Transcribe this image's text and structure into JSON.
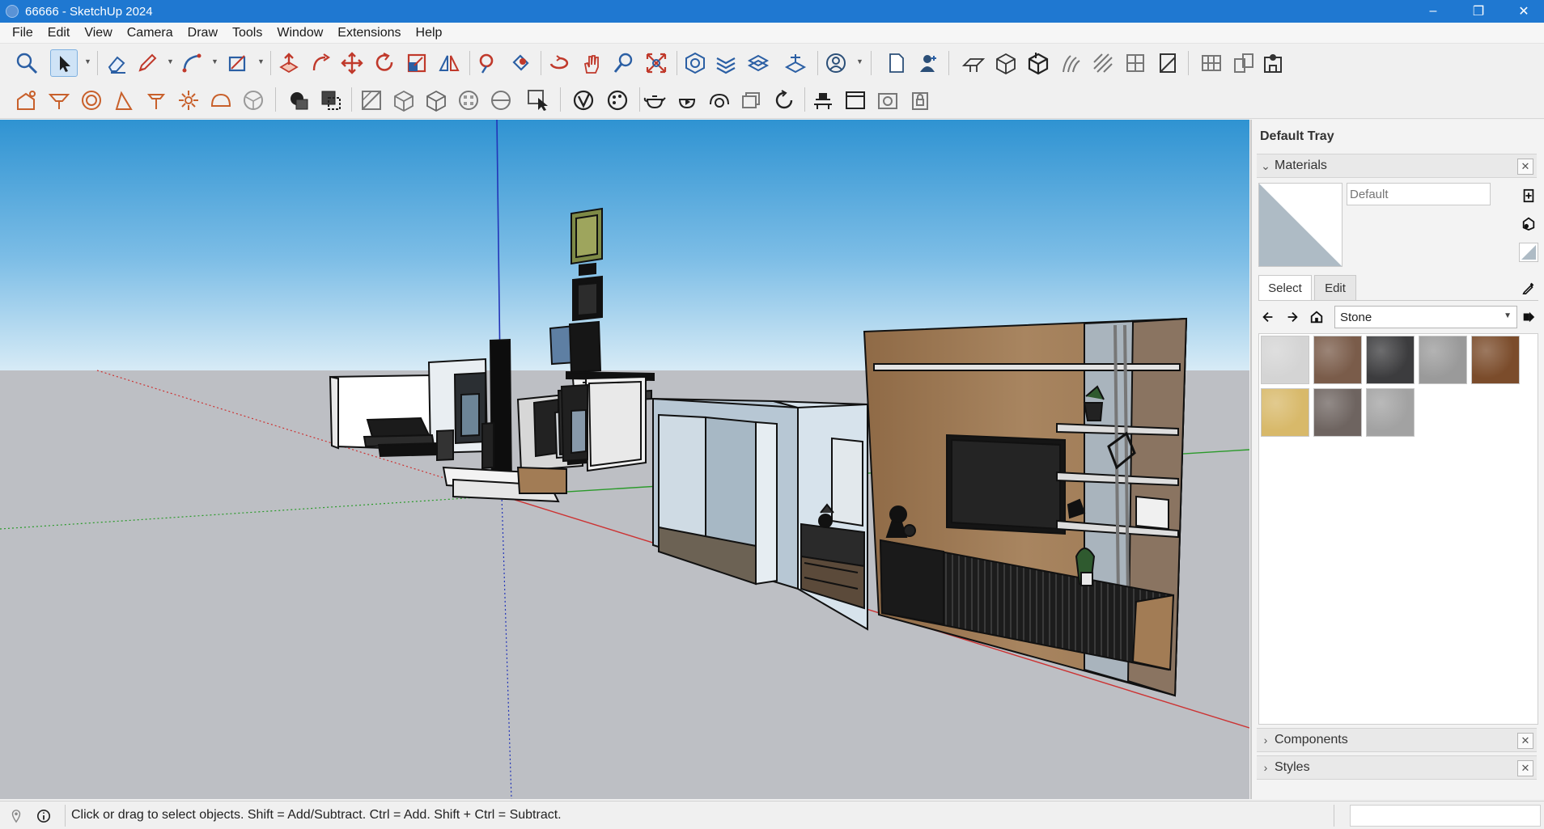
{
  "app": {
    "window_title": "66666 - SketchUp 2024",
    "window_controls": {
      "minimize": "–",
      "restore": "❐",
      "close": "✕"
    }
  },
  "menu": [
    "File",
    "Edit",
    "View",
    "Camera",
    "Draw",
    "Tools",
    "Window",
    "Extensions",
    "Help"
  ],
  "toolbar_large": [
    {
      "name": "zoom-tool",
      "icon": "magnifier"
    },
    {
      "name": "select-tool",
      "icon": "arrow-cursor",
      "active": true
    },
    {
      "name": "eraser-tool",
      "icon": "eraser"
    },
    {
      "name": "line-tool",
      "icon": "pencil"
    },
    {
      "name": "arc-tool",
      "icon": "arc"
    },
    {
      "name": "rectangle-tool",
      "icon": "rectangle"
    },
    {
      "name": "push-pull-tool",
      "icon": "push-pull"
    },
    {
      "name": "follow-me-tool",
      "icon": "follow-me"
    },
    {
      "name": "move-tool",
      "icon": "move"
    },
    {
      "name": "rotate-tool",
      "icon": "rotate"
    },
    {
      "name": "scale-tool",
      "icon": "scale"
    },
    {
      "name": "flip-tool",
      "icon": "flip"
    },
    {
      "name": "tape-measure-tool",
      "icon": "tape"
    },
    {
      "name": "paint-bucket-tool",
      "icon": "paint-bucket"
    },
    {
      "name": "orbit-tool",
      "icon": "orbit"
    },
    {
      "name": "pan-tool",
      "icon": "hand"
    },
    {
      "name": "zoom-window-tool",
      "icon": "zoom"
    },
    {
      "name": "zoom-extents-tool",
      "icon": "zoom-extents"
    },
    {
      "name": "sandbox-smoove-tool",
      "icon": "smoove"
    },
    {
      "name": "sandbox-stamp-tool",
      "icon": "stamp"
    },
    {
      "name": "sandbox-drape-tool",
      "icon": "drape"
    },
    {
      "name": "sandbox-flip-edge-tool",
      "icon": "flip-edge"
    },
    {
      "name": "account-button",
      "icon": "user-circle"
    },
    {
      "name": "new-file-button",
      "icon": "page"
    },
    {
      "name": "add-user-button",
      "icon": "person"
    },
    {
      "name": "section-plane-tool",
      "icon": "section"
    },
    {
      "name": "solid-outer-shell-tool",
      "icon": "box"
    },
    {
      "name": "solid-intersect-tool",
      "icon": "box-cut"
    },
    {
      "name": "solid-union-tool",
      "icon": "solid"
    },
    {
      "name": "solid-subtract-tool",
      "icon": "solid"
    },
    {
      "name": "solid-trim-tool",
      "icon": "solid"
    },
    {
      "name": "solid-split-tool",
      "icon": "solid"
    },
    {
      "name": "solid-inspector-tool",
      "icon": "solid"
    },
    {
      "name": "grid-tool",
      "icon": "grid"
    },
    {
      "name": "layout-tool",
      "icon": "layout"
    },
    {
      "name": "warehouse-tool",
      "icon": "warehouse"
    }
  ],
  "toolbar_small": [
    {
      "name": "photo-texture-tool",
      "icon": "photo"
    },
    {
      "name": "position-camera-tool",
      "icon": "camera"
    },
    {
      "name": "walk-tool",
      "icon": "walk"
    },
    {
      "name": "look-around-tool",
      "icon": "look"
    },
    {
      "name": "section-fill-tool",
      "icon": "section"
    },
    {
      "name": "shadows-tool",
      "icon": "sun"
    },
    {
      "name": "fog-tool",
      "icon": "fog"
    },
    {
      "name": "x-ray-tool",
      "icon": "sphere"
    },
    {
      "name": "back-edges-tool",
      "icon": "edges"
    },
    {
      "name": "wireframe-tool",
      "icon": "wire"
    },
    {
      "name": "hidden-line-tool",
      "icon": "hidden"
    },
    {
      "name": "shaded-tool",
      "icon": "shaded"
    },
    {
      "name": "textured-tool",
      "icon": "textured"
    },
    {
      "name": "monochrome-tool",
      "icon": "mono"
    },
    {
      "name": "components-browser-tool",
      "icon": "components"
    },
    {
      "name": "extension-warehouse-tool",
      "icon": "ext"
    },
    {
      "name": "style-builder-tool",
      "icon": "style"
    },
    {
      "name": "render-teapot-tool",
      "icon": "teapot"
    },
    {
      "name": "render-play-tool",
      "icon": "play"
    },
    {
      "name": "render-settings-tool",
      "icon": "settings"
    },
    {
      "name": "render-frame-tool",
      "icon": "frame"
    },
    {
      "name": "render-refresh-tool",
      "icon": "refresh"
    },
    {
      "name": "render-table-tool",
      "icon": "table"
    },
    {
      "name": "render-window-tool",
      "icon": "window"
    },
    {
      "name": "render-camera-tool",
      "icon": "camera-box"
    },
    {
      "name": "render-lock-tool",
      "icon": "lock"
    }
  ],
  "tray": {
    "title": "Default Tray",
    "materials_label": "Materials",
    "material_name_placeholder": "Default",
    "tab_select": "Select",
    "tab_edit": "Edit",
    "collection": "Stone",
    "swatches": [
      {
        "name": "marble-white",
        "color": "#d4d4d4"
      },
      {
        "name": "granite-brown",
        "color": "#7a5c4a"
      },
      {
        "name": "granite-dark",
        "color": "#3c3c3e"
      },
      {
        "name": "stone-grey",
        "color": "#9a9a9a"
      },
      {
        "name": "stone-brown",
        "color": "#7b4c2b"
      },
      {
        "name": "sandstone-yellow",
        "color": "#d8b96a"
      },
      {
        "name": "granite-mixed",
        "color": "#6e6460"
      },
      {
        "name": "granite-light",
        "color": "#a2a2a2"
      }
    ],
    "components_label": "Components",
    "styles_label": "Styles"
  },
  "status": {
    "text": "Click or drag to select objects. Shift = Add/Subtract. Ctrl = Add. Shift + Ctrl = Subtract."
  },
  "colors": {
    "title_bar": "#1f78d1",
    "sky_top": "#3b9ed6",
    "sky_bottom": "#cfe5f3",
    "ground": "#bdbfc4",
    "wood": "#a27c55",
    "accent_tool": "#c8602b"
  }
}
